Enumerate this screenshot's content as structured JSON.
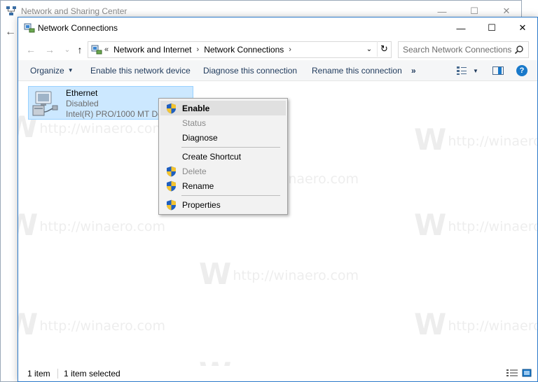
{
  "bg_window": {
    "title": "Network and Sharing Center",
    "min": "—",
    "max": "☐",
    "close": "✕",
    "back": "←"
  },
  "window": {
    "title": "Network Connections",
    "min": "—",
    "max": "☐",
    "close": "✕"
  },
  "nav": {
    "back": "←",
    "forward": "→",
    "recent": "⌄",
    "up": "↑"
  },
  "address": {
    "prefix": "«",
    "segments": [
      "Network and Internet",
      "Network Connections"
    ],
    "sep": "›",
    "dropdown": "⌄",
    "refresh": "↻"
  },
  "search": {
    "placeholder": "Search Network Connections"
  },
  "commands": {
    "organize": "Organize",
    "organize_caret": "▼",
    "enable_device": "Enable this network device",
    "diagnose": "Diagnose this connection",
    "rename": "Rename this connection",
    "more": "»",
    "view_caret": "▼",
    "help": "?"
  },
  "connection": {
    "name": "Ethernet",
    "status": "Disabled",
    "device": "Intel(R) PRO/1000 MT Desktop Adapter"
  },
  "context_menu": {
    "enable": "Enable",
    "status": "Status",
    "diagnose": "Diagnose",
    "create_shortcut": "Create Shortcut",
    "delete": "Delete",
    "rename": "Rename",
    "properties": "Properties"
  },
  "status_bar": {
    "count": "1 item",
    "selected": "1 item selected"
  },
  "watermark": {
    "w": "W",
    "text": "http://winaero.com"
  },
  "colors": {
    "accent": "#1979ca",
    "selection": "#cce8ff",
    "shield_blue": "#1f5fbf",
    "shield_yellow": "#f4c430"
  }
}
